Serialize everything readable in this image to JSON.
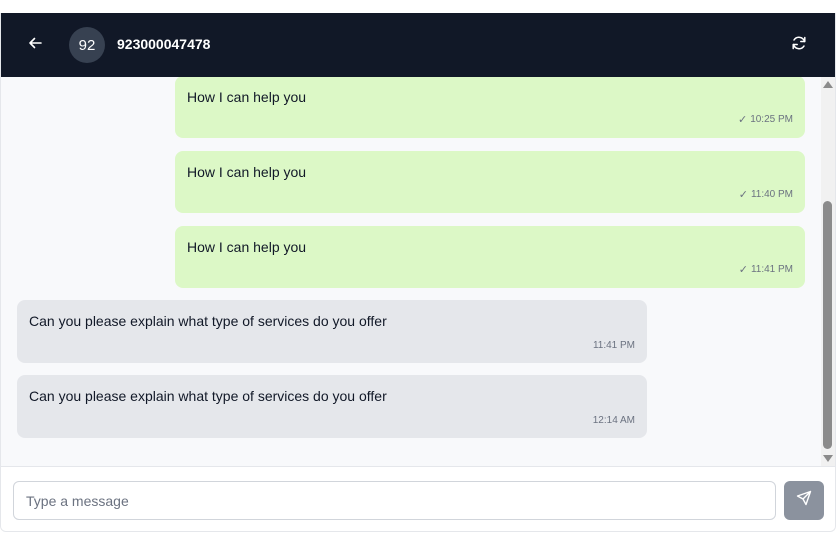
{
  "header": {
    "avatar_initials": "92",
    "contact_name": "923000047478"
  },
  "messages": [
    {
      "direction": "out",
      "text": "How I can help you",
      "time": "10:25 PM",
      "status": "sent"
    },
    {
      "direction": "out",
      "text": "How I can help you",
      "time": "11:40 PM",
      "status": "sent"
    },
    {
      "direction": "out",
      "text": "How I can help you",
      "time": "11:41 PM",
      "status": "sent"
    },
    {
      "direction": "in",
      "text": "Can you please explain what type of services do you offer",
      "time": "11:41 PM"
    },
    {
      "direction": "in",
      "text": "Can you please explain what type of services do you offer",
      "time": "12:14 AM"
    }
  ],
  "composer": {
    "placeholder": "Type a message",
    "value": ""
  },
  "colors": {
    "header_bg": "#111827",
    "outgoing_bubble": "#dcf8c6",
    "incoming_bubble": "#e5e7eb",
    "send_button": "#8b929e"
  },
  "icons": {
    "back": "arrow-left-icon",
    "refresh": "refresh-icon",
    "send": "send-icon",
    "check": "check-icon"
  }
}
